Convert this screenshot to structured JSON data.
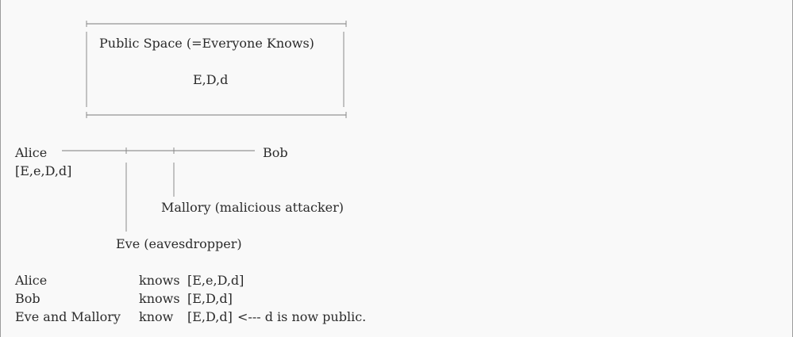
{
  "public_space": {
    "title": "Public Space (=Everyone Knows)",
    "keys": "E,D,d"
  },
  "parties": {
    "alice": "Alice",
    "alice_keys": "[E,e,D,d]",
    "bob": "Bob",
    "mallory": "Mallory (malicious attacker)",
    "eve": "Eve (eavesdropper)"
  },
  "summary": [
    {
      "who": "Alice",
      "verb": "knows",
      "keys": "[E,e,D,d]",
      "note": ""
    },
    {
      "who": "Bob",
      "verb": "knows",
      "keys": "[E,D,d]",
      "note": ""
    },
    {
      "who": "Eve and Mallory",
      "verb": "know",
      "keys": "[E,D,d]",
      "note": "<--- d is now public."
    }
  ]
}
